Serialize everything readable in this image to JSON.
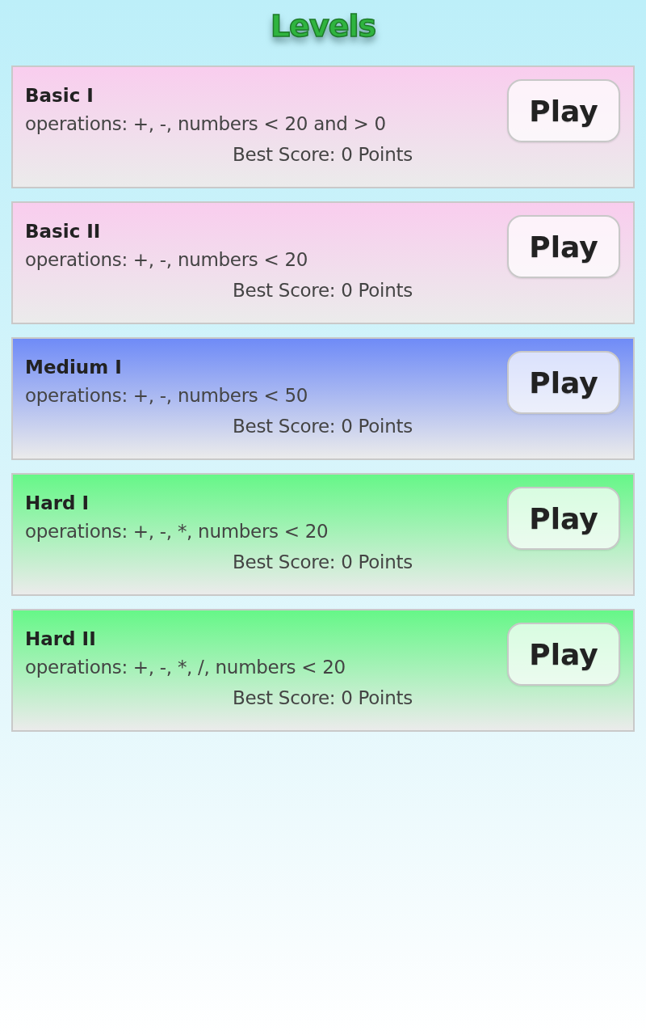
{
  "title": "Levels",
  "levels": [
    {
      "name": "Basic I",
      "description": "operations: +, -, numbers < 20 and > 0",
      "best_score": "Best Score: 0 Points",
      "button": "Play",
      "color": "#f9cdee"
    },
    {
      "name": "Basic II",
      "description": "operations: +, -, numbers < 20",
      "best_score": "Best Score: 0 Points",
      "button": "Play",
      "color": "#f9cdee"
    },
    {
      "name": "Medium I",
      "description": "operations: +, -, numbers < 50",
      "best_score": "Best Score: 0 Points",
      "button": "Play",
      "color": "#6f8bf7"
    },
    {
      "name": "Hard I",
      "description": "operations: +, -, *, numbers < 20",
      "best_score": "Best Score: 0 Points",
      "button": "Play",
      "color": "#66f788"
    },
    {
      "name": "Hard II",
      "description": "operations: +, -, *, /, numbers < 20",
      "best_score": "Best Score: 0 Points",
      "button": "Play",
      "color": "#66f788"
    }
  ]
}
